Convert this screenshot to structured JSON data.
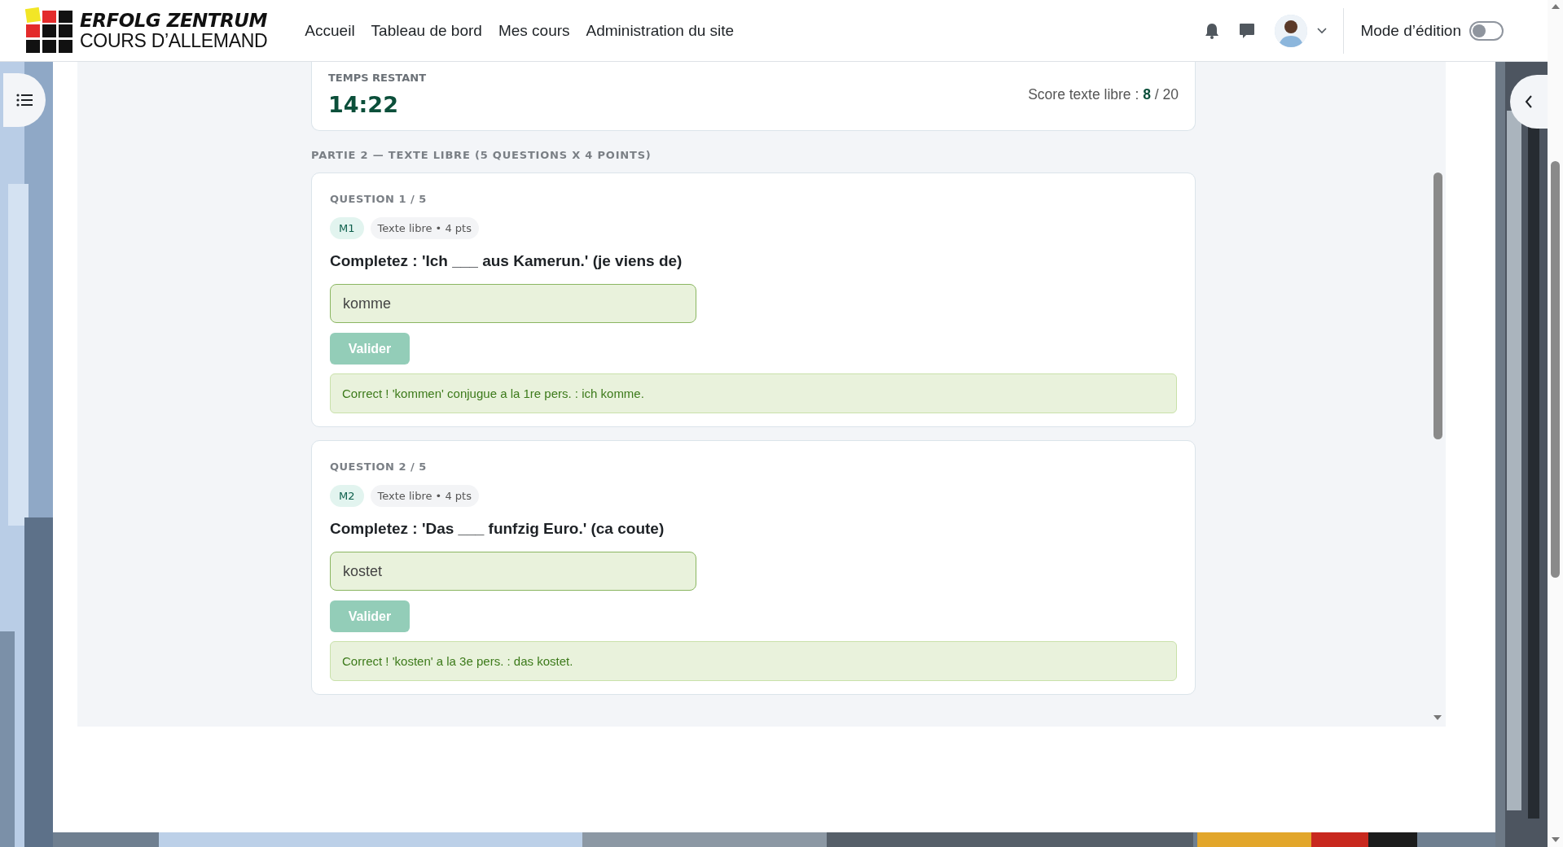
{
  "header": {
    "logo": {
      "title": "ERFOLG ZENTRUM",
      "subtitle": "COURS D’ALLEMAND"
    },
    "nav": [
      {
        "label": "Accueil"
      },
      {
        "label": "Tableau de bord"
      },
      {
        "label": "Mes cours"
      },
      {
        "label": "Administration du site"
      }
    ],
    "edit_mode": {
      "label": "Mode d’édition",
      "on": false
    }
  },
  "timer": {
    "label": "TEMPS RESTANT",
    "time": "14:22",
    "score_label": "Score texte libre :",
    "score": "8",
    "score_total": "/ 20"
  },
  "section_title": "PARTIE 2 — TEXTE LIBRE (5 QUESTIONS X 4 POINTS)",
  "questions": [
    {
      "number": "QUESTION 1 / 5",
      "code": "M1",
      "type": "Texte libre • 4 pts",
      "prompt": "Completez : 'Ich ___ aus Kamerun.' (je viens de)",
      "answer": "komme",
      "button": "Valider",
      "disabled": true,
      "correct": true,
      "feedback": "Correct ! 'kommen' conjugue a la 1re pers. : ich komme."
    },
    {
      "number": "QUESTION 2 / 5",
      "code": "M2",
      "type": "Texte libre • 4 pts",
      "prompt": "Completez : 'Das ___ funfzig Euro.' (ca coute)",
      "answer": "kostet",
      "button": "Valider",
      "disabled": true,
      "correct": true,
      "feedback": "Correct ! 'kosten' a la 3e pers. : das kostet."
    }
  ]
}
